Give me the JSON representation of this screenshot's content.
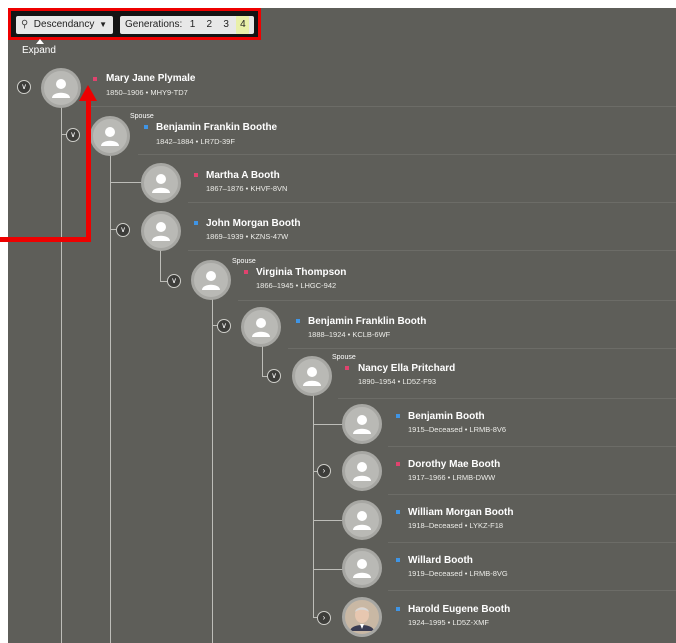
{
  "toolbar": {
    "view_select_label": "Descendancy",
    "generations_label": "Generations:",
    "generation_options": [
      "1",
      "2",
      "3",
      "4"
    ],
    "active_generation": "4"
  },
  "expand_label": "Expand",
  "spouse_label": "Spouse",
  "persons": [
    {
      "name": "Mary Jane Plymale",
      "detail": "1850–1906 • MHY9-TD7",
      "gender": "female"
    },
    {
      "name": "Benjamin Frankin Boothe",
      "detail": "1842–1884 • LR7D-39F",
      "gender": "male"
    },
    {
      "name": "Martha A Booth",
      "detail": "1867–1876 • KHVF-8VN",
      "gender": "female"
    },
    {
      "name": "John Morgan Booth",
      "detail": "1869–1939 • KZNS-47W",
      "gender": "male"
    },
    {
      "name": "Virginia Thompson",
      "detail": "1866–1945 • LHGC-942",
      "gender": "female"
    },
    {
      "name": "Benjamin Franklin Booth",
      "detail": "1888–1924 • KCLB-6WF",
      "gender": "male"
    },
    {
      "name": "Nancy Ella Pritchard",
      "detail": "1890–1954 • LD5Z-F93",
      "gender": "female"
    },
    {
      "name": "Benjamin Booth",
      "detail": "1915–Deceased • LRMB-8V6",
      "gender": "male"
    },
    {
      "name": "Dorothy Mae Booth",
      "detail": "1917–1966 • LRMB-DWW",
      "gender": "female"
    },
    {
      "name": "William Morgan Booth",
      "detail": "1918–Deceased • LYKZ-F18",
      "gender": "male"
    },
    {
      "name": "Willard Booth",
      "detail": "1919–Deceased • LRMB-8VG",
      "gender": "male"
    },
    {
      "name": "Harold Eugene Booth",
      "detail": "1924–1995 • LD5Z-XMF",
      "gender": "male"
    }
  ],
  "colors": {
    "panel_bg": "#5e5e59",
    "female_marker": "#e0436e",
    "male_marker": "#3f95e6",
    "highlight": "#ee0000"
  }
}
